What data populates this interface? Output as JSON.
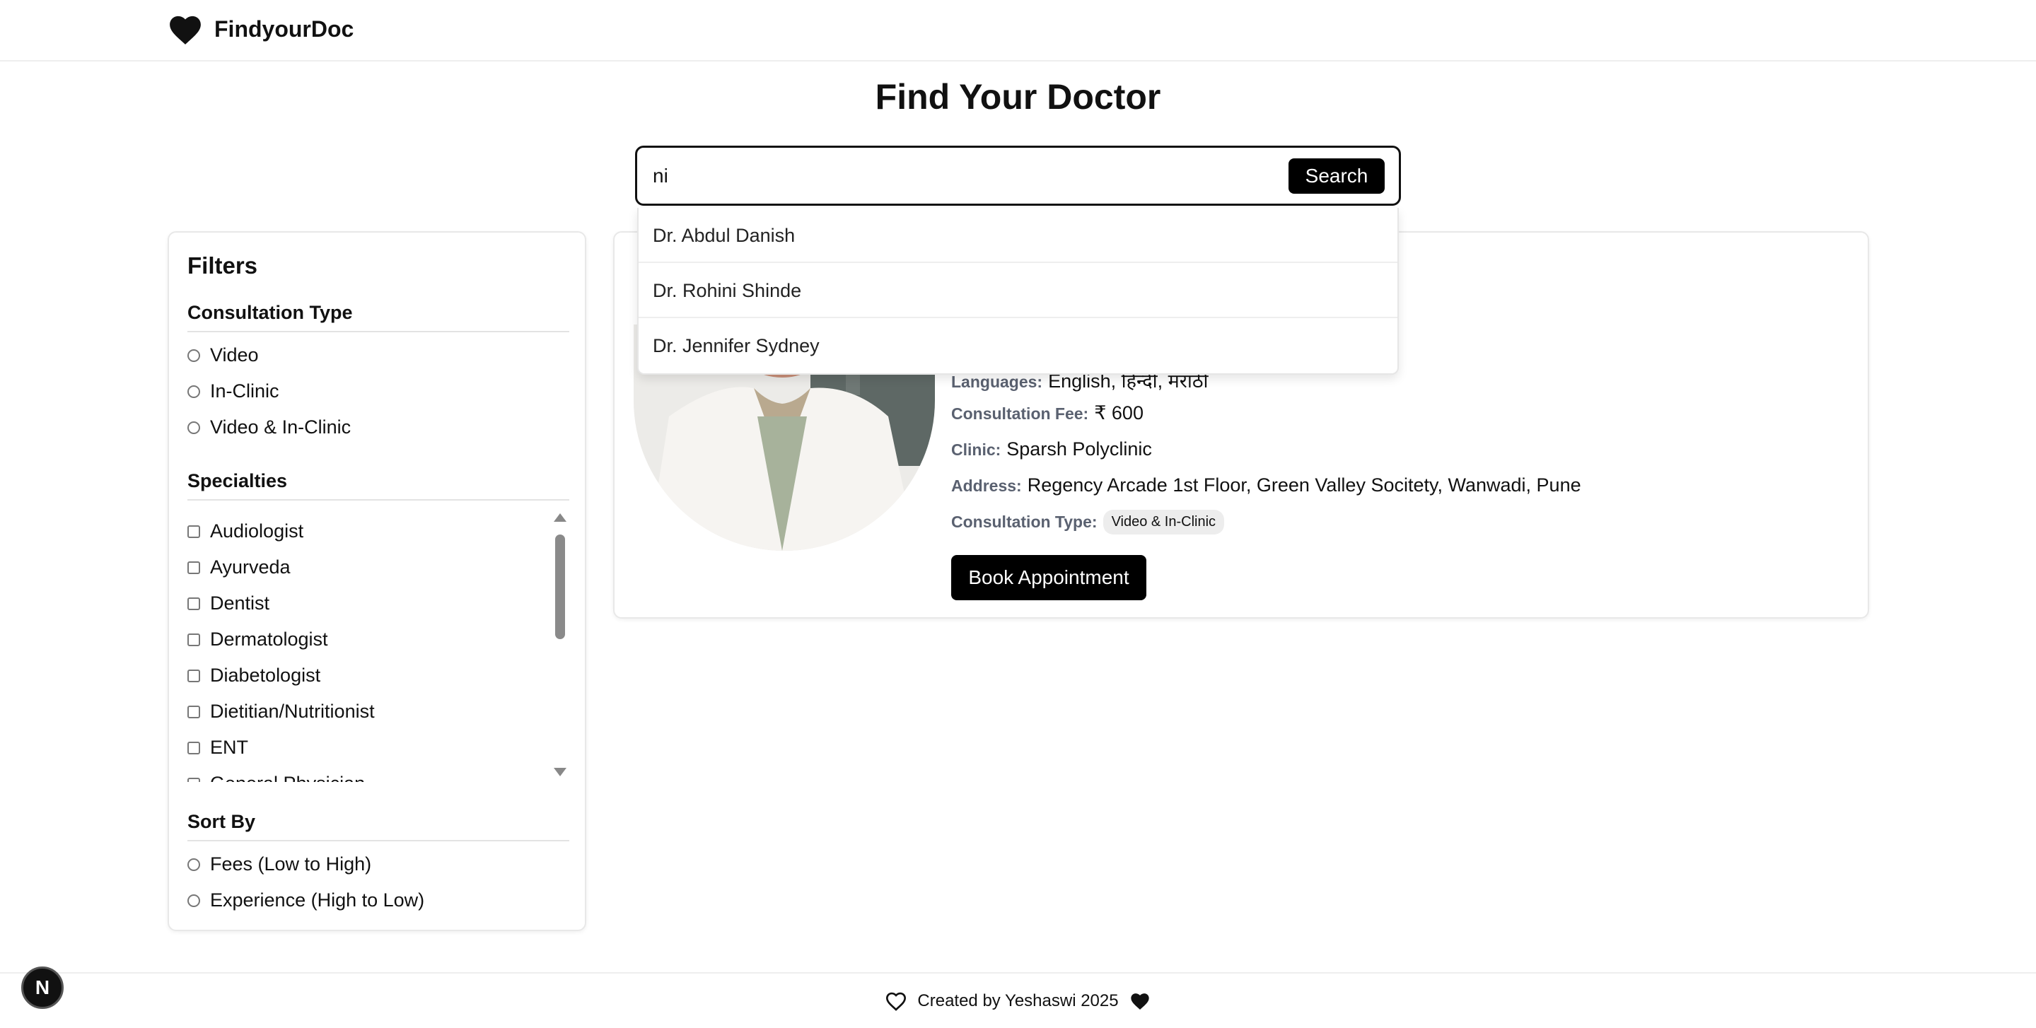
{
  "header": {
    "brand": "FindyourDoc",
    "logo_icon": "heart-icon"
  },
  "page_title": "Find Your Doctor",
  "search": {
    "value": "ni",
    "button_label": "Search",
    "suggestions": [
      "Dr. Abdul Danish",
      "Dr. Rohini Shinde",
      "Dr. Jennifer Sydney"
    ]
  },
  "filters": {
    "title": "Filters",
    "consultation_type": {
      "title": "Consultation Type",
      "options": [
        "Video",
        "In-Clinic",
        "Video & In-Clinic"
      ]
    },
    "specialties": {
      "title": "Specialties",
      "items": [
        "Audiologist",
        "Ayurveda",
        "Dentist",
        "Dermatologist",
        "Diabetologist",
        "Dietitian/Nutritionist",
        "ENT",
        "General Physician"
      ]
    },
    "sort_by": {
      "title": "Sort By",
      "options": [
        "Fees (Low to High)",
        "Experience (High to Low)"
      ]
    }
  },
  "doctor_card": {
    "languages_label": "Languages:",
    "languages": "English, हिन्दी, मराठी",
    "fee_label": "Consultation Fee:",
    "fee": "₹ 600",
    "clinic_label": "Clinic:",
    "clinic": "Sparsh Polyclinic",
    "address_label": "Address:",
    "address": "Regency Arcade 1st Floor, Green Valley Socitety, Wanwadi, Pune",
    "consultation_type_label": "Consultation Type:",
    "consultation_type": "Video & In-Clinic",
    "book_label": "Book Appointment"
  },
  "footer": {
    "text": "Created by Yeshaswi 2025"
  },
  "dev_badge": "N",
  "colors": {
    "primary": "#000000",
    "border": "#e8e8e8",
    "label": "#5a6170",
    "badge_bg": "#ededed"
  }
}
